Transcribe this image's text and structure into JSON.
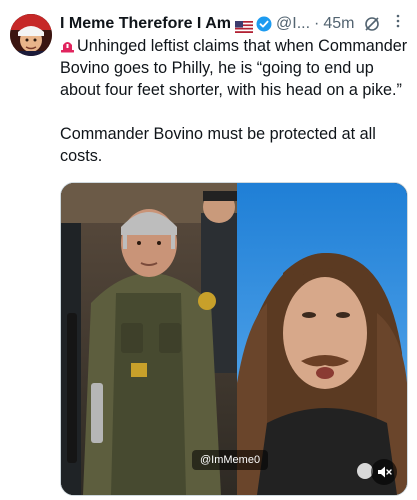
{
  "author": {
    "display_name": "I Meme Therefore I Am",
    "handle": "@I...",
    "time": "45m"
  },
  "icons": {
    "flag": "us-flag-icon",
    "verified": "verified-badge-icon",
    "grok": "grok-icon",
    "more": "more-options-icon",
    "siren": "siren-icon",
    "mute": "muted-speaker-icon"
  },
  "tweet": {
    "line1": "Unhinged leftist claims that when Commander Bovino goes to Philly, he is “going to end up about four feet shorter, with his head on a pike.”",
    "line2": "Commander Bovino must be protected at all costs."
  },
  "media": {
    "watermark": "@ImMeme0"
  },
  "colors": {
    "text": "#0f1419",
    "secondary": "#536471",
    "verified": "#1d9bf0",
    "siren": "#e0245e"
  }
}
